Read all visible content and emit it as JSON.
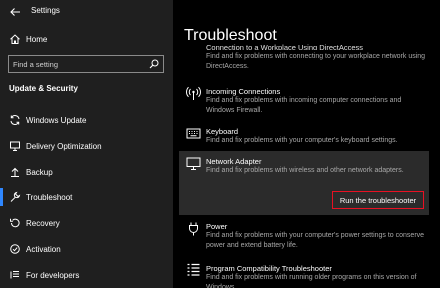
{
  "window": {
    "title": "Settings"
  },
  "sidebar": {
    "home_label": "Home",
    "search_placeholder": "Find a setting",
    "section_title": "Update & Security",
    "items": [
      {
        "label": "Windows Update",
        "icon": "sync-icon"
      },
      {
        "label": "Delivery Optimization",
        "icon": "delivery-icon"
      },
      {
        "label": "Backup",
        "icon": "backup-icon"
      },
      {
        "label": "Troubleshoot",
        "icon": "wrench-icon",
        "active": true
      },
      {
        "label": "Recovery",
        "icon": "recovery-icon"
      },
      {
        "label": "Activation",
        "icon": "activation-icon"
      },
      {
        "label": "For developers",
        "icon": "developer-icon"
      }
    ],
    "accent_color": "#2f87ff"
  },
  "main": {
    "title": "Troubleshoot",
    "partial_tile": {
      "name": "Connection to a Workplace Using DirectAccess",
      "description": "Find and fix problems with connecting to your workplace network using DirectAccess."
    },
    "tiles": [
      {
        "name": "Incoming Connections",
        "description": "Find and fix problems with incoming computer connections and Windows Firewall.",
        "icon": "antenna-icon"
      },
      {
        "name": "Keyboard",
        "description": "Find and fix problems with your computer's keyboard settings.",
        "icon": "keyboard-icon"
      },
      {
        "name": "Network Adapter",
        "description": "Find and fix problems with wireless and other network adapters.",
        "icon": "monitor-icon",
        "expanded": true
      },
      {
        "name": "Power",
        "description": "Find and fix problems with your computer's power settings to conserve power and extend battery life.",
        "icon": "power-plug-icon"
      },
      {
        "name": "Program Compatibility Troubleshooter",
        "description": "Find and fix problems with running older programs on this version of Windows.",
        "icon": "list-icon"
      }
    ],
    "run_button_label": "Run the troubleshooter",
    "run_button_border_color": "#e81123"
  }
}
